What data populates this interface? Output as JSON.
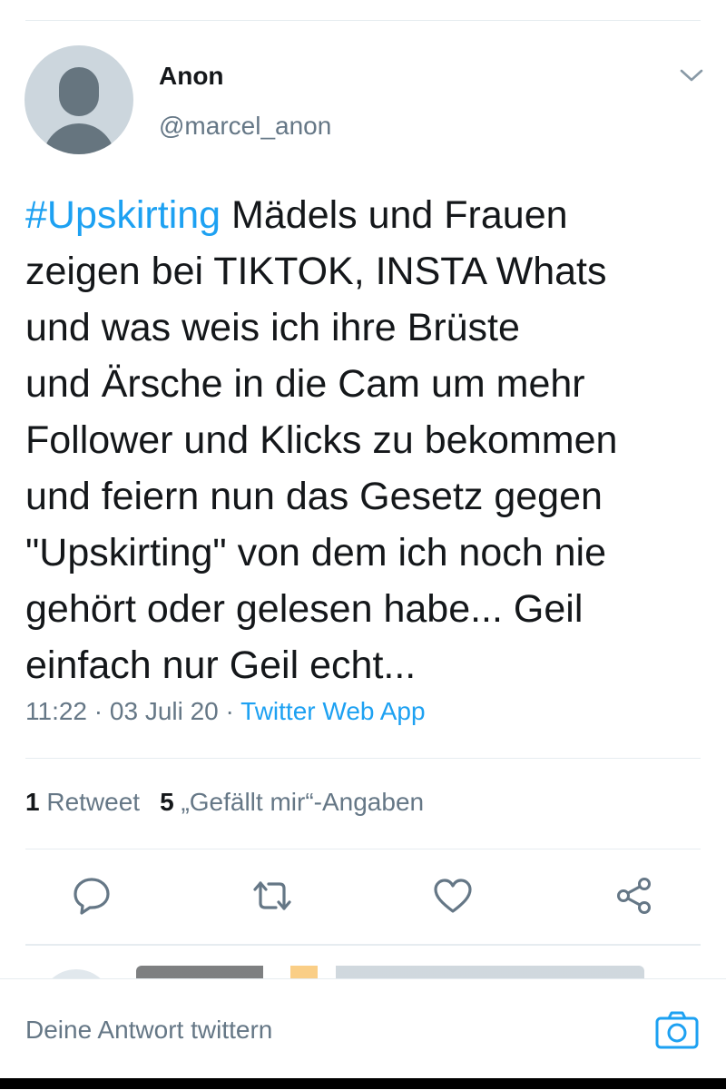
{
  "tweet": {
    "author": {
      "display_name": "Anon",
      "handle": "@marcel_anon",
      "avatar_icon": "default-profile-icon"
    },
    "hashtag": "#Upskirting",
    "text": " Mädels und Frauen\nzeigen bei TIKTOK, INSTA Whats\nund was weis ich ihre Brüste\nund Ärsche in die Cam um mehr\nFollower und Klicks zu bekommen\nund feiern nun das Gesetz gegen\n\"Upskirting\" von dem ich noch nie\ngehört oder gelesen habe... Geil\neinfach nur Geil echt...",
    "time": "11:22",
    "separator": "·",
    "date": "03 Juli 20",
    "source": "Twitter Web App",
    "stats": {
      "retweet_count": "1",
      "retweet_label": "Retweet",
      "like_count": "5",
      "like_label": "„Gefällt mir“-Angaben"
    },
    "actions": [
      {
        "name": "reply-icon"
      },
      {
        "name": "retweet-icon"
      },
      {
        "name": "like-icon"
      },
      {
        "name": "share-icon"
      }
    ]
  },
  "composer": {
    "placeholder": "Deine Antwort twittern",
    "camera_icon": "camera-icon"
  },
  "colors": {
    "accent": "#1da1f2",
    "secondary_text": "#657786",
    "primary_text": "#14171a",
    "divider": "#e6ecf0"
  }
}
